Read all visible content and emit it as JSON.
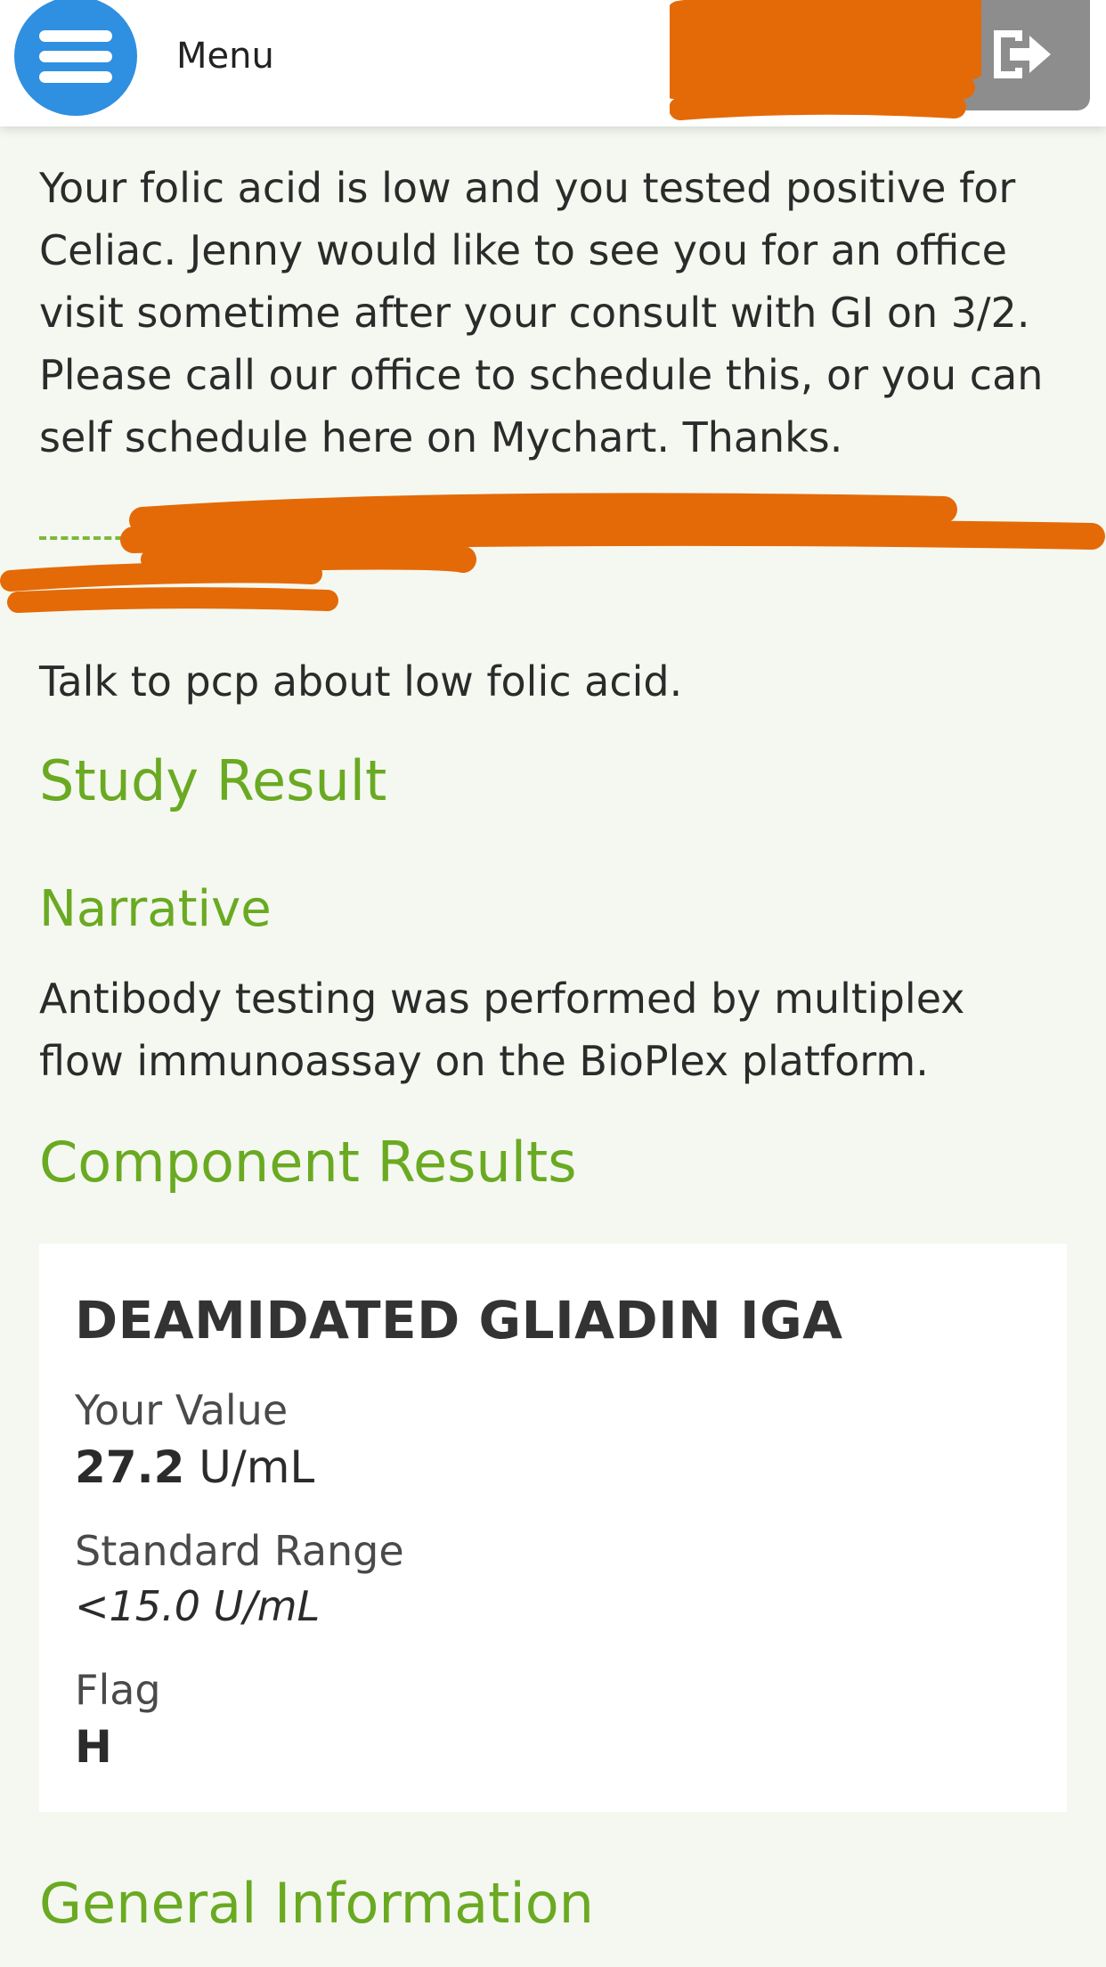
{
  "header": {
    "menu_label": "Menu",
    "accent_color": "#2f8fe0"
  },
  "message": {
    "body": "Your folic acid is low and you tested positive for Celiac. Jenny would like to see you for an office visit sometime after your consult with GI on 3/2. Please call our office to schedule this, or you can self schedule here on Mychart. Thanks."
  },
  "note": "Talk to pcp about low folic acid.",
  "study": {
    "heading": "Study Result",
    "narrative_heading": "Narrative",
    "narrative_text": "Antibody testing was performed by multiplex flow immunoassay on the BioPlex platform."
  },
  "components": {
    "heading": "Component Results",
    "items": [
      {
        "name": "DEAMIDATED GLIADIN IGA",
        "value_label": "Your Value",
        "value": "27.2",
        "unit": "U/mL",
        "range_label": "Standard Range",
        "range": "<15.0 U/mL",
        "flag_label": "Flag",
        "flag": "H"
      }
    ]
  },
  "general": {
    "heading": "General Information"
  },
  "colors": {
    "heading_green": "#6aaa22",
    "redaction_orange": "#e46a08",
    "background": "#f5f8f0"
  }
}
